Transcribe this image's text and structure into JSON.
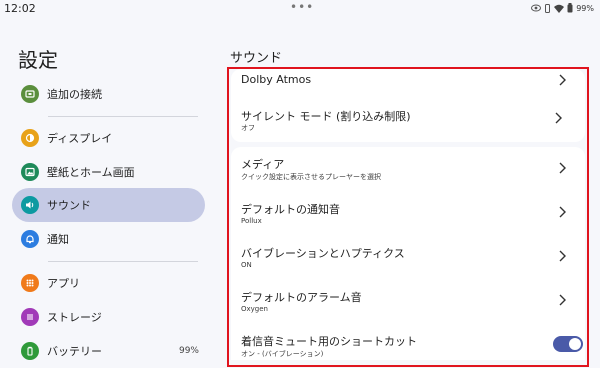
{
  "status_bar": {
    "time": "12:02",
    "dots": "•••",
    "battery": "99%"
  },
  "sidebar": {
    "title": "設定",
    "items": [
      {
        "label": "追加の接続",
        "icon": "connections-icon",
        "color": "#5b8f3d",
        "value": ""
      },
      {
        "label": "ディスプレイ",
        "icon": "display-icon",
        "color": "#e8a219",
        "value": ""
      },
      {
        "label": "壁紙とホーム画面",
        "icon": "wallpaper-icon",
        "color": "#1f8a5a",
        "value": ""
      },
      {
        "label": "サウンド",
        "icon": "volume-icon",
        "color": "#0d9aa1",
        "value": ""
      },
      {
        "label": "通知",
        "icon": "bell-icon",
        "color": "#2d7de0",
        "value": ""
      },
      {
        "label": "アプリ",
        "icon": "apps-icon",
        "color": "#f07a1a",
        "value": ""
      },
      {
        "label": "ストレージ",
        "icon": "storage-icon",
        "color": "#a13ab8",
        "value": ""
      },
      {
        "label": "バッテリー",
        "icon": "battery-icon",
        "color": "#2f9a3a",
        "value": "99%"
      }
    ]
  },
  "main": {
    "section_title": "サウンド",
    "rows": [
      {
        "title": "Dolby Atmos",
        "subtitle": ""
      },
      {
        "title": "サイレント モード (割り込み制限)",
        "subtitle": "オフ"
      },
      {
        "title": "メディア",
        "subtitle": "クイック設定に表示させるプレーヤーを選択"
      },
      {
        "title": "デフォルトの通知音",
        "subtitle": "Pollux"
      },
      {
        "title": "バイブレーションとハプティクス",
        "subtitle": "ON"
      },
      {
        "title": "デフォルトのアラーム音",
        "subtitle": "Oxygen"
      },
      {
        "title": "着信音ミュート用のショートカット",
        "subtitle": "オン - (バイブレーション)"
      }
    ],
    "shortcut_toggle_on": true
  },
  "colors": {
    "accent": "#4a5aa8",
    "active_nav": "#c5cae5",
    "highlight_box": "#e0141e"
  }
}
